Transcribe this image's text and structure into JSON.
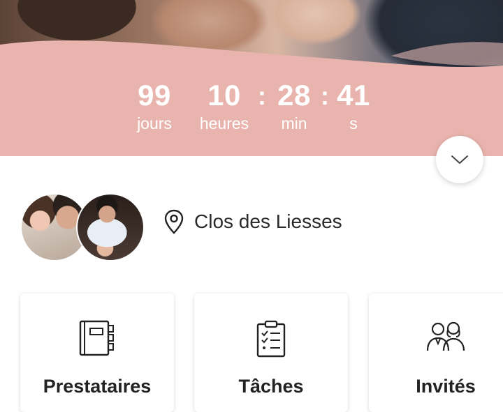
{
  "countdown": {
    "days": {
      "value": "99",
      "label": "jours"
    },
    "hours": {
      "value": "10",
      "label": "heures"
    },
    "minutes": {
      "value": "28",
      "label": "min"
    },
    "seconds": {
      "value": "41",
      "label": "s"
    },
    "separator": ":"
  },
  "location": {
    "name": "Clos des Liesses",
    "icon": "map-pin-icon"
  },
  "cards": [
    {
      "label": "Prestataires",
      "icon": "notebook-icon"
    },
    {
      "label": "Tâches",
      "icon": "checklist-icon"
    },
    {
      "label": "Invités",
      "icon": "guests-icon"
    }
  ],
  "colors": {
    "accent_pink": "#e9b4ad",
    "text": "#1f1f1f"
  }
}
